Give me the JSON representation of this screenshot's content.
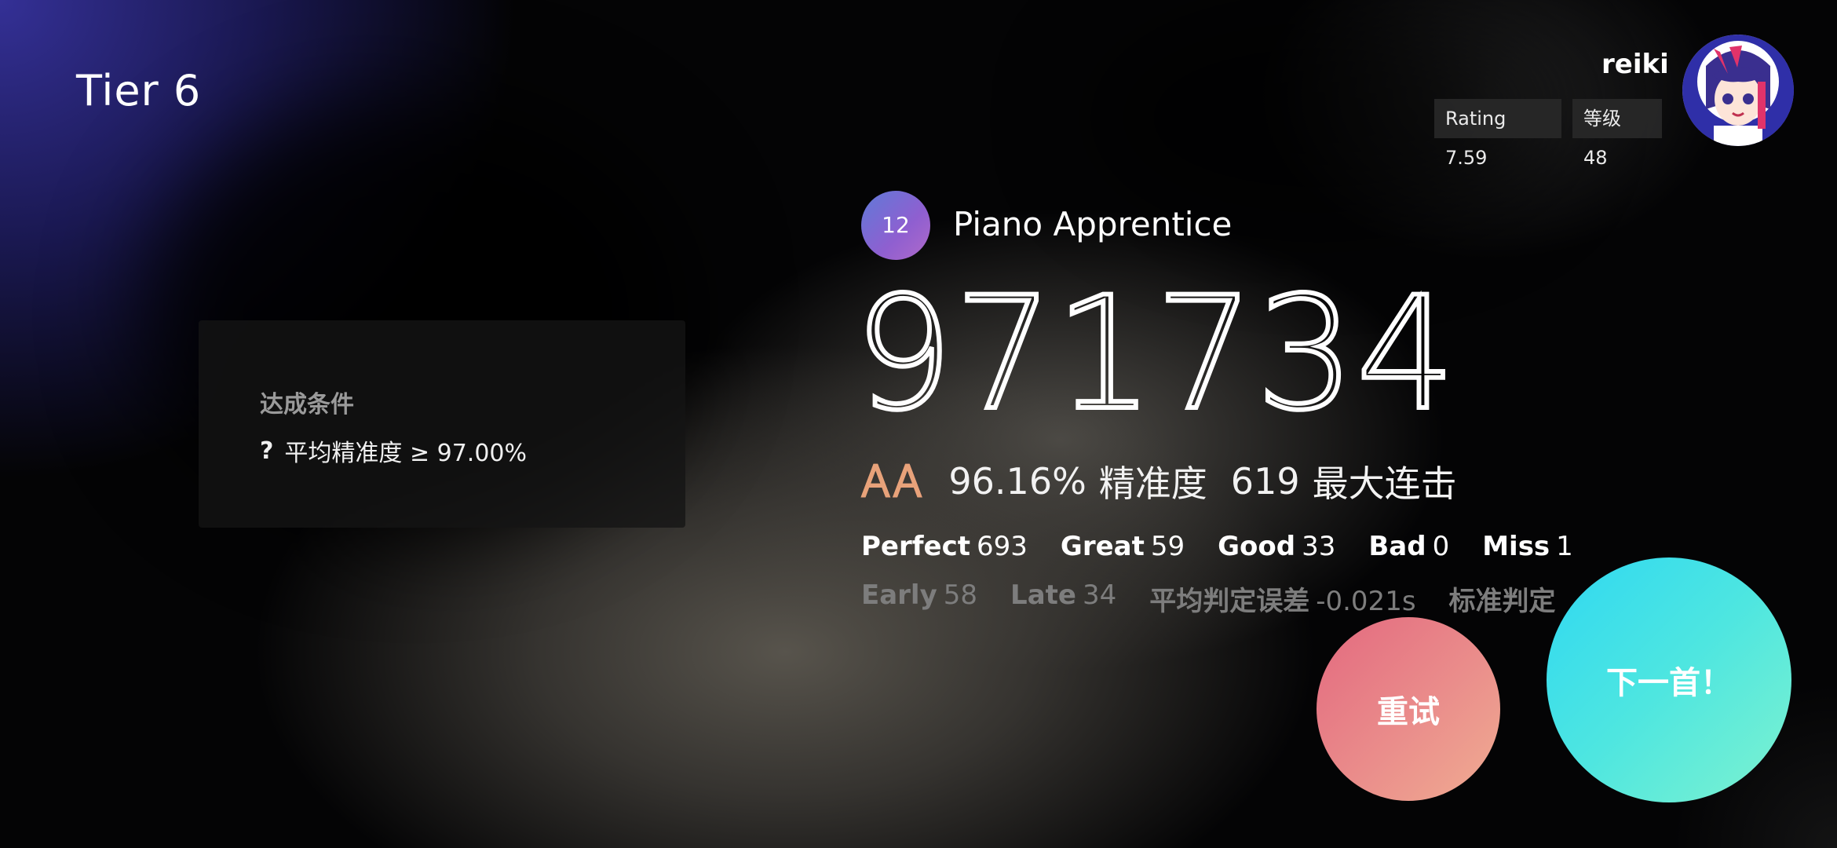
{
  "tier": {
    "title": "Tier 6"
  },
  "player": {
    "name": "reiki",
    "rating_label": "Rating 7.59",
    "level_label": "等级 48",
    "avatar_icon": "anime-avatar"
  },
  "conditions": {
    "title": "达成条件",
    "items": [
      {
        "icon": "?",
        "text": "平均精准度 ≥ 97.00%"
      }
    ]
  },
  "song": {
    "level": "12",
    "title": "Piano Apprentice"
  },
  "result": {
    "score": "971734",
    "grade": "AA",
    "accuracy": "96.16%",
    "accuracy_label": "精准度",
    "max_combo": "619",
    "max_combo_label": "最大连击"
  },
  "judgements": [
    {
      "label": "Perfect",
      "value": "693"
    },
    {
      "label": "Great",
      "value": "59"
    },
    {
      "label": "Good",
      "value": "33"
    },
    {
      "label": "Bad",
      "value": "0"
    },
    {
      "label": "Miss",
      "value": "1"
    }
  ],
  "timing": {
    "early_label": "Early",
    "early_value": "58",
    "late_label": "Late",
    "late_value": "34",
    "avg_offset_label": "平均判定误差",
    "avg_offset_value": "-0.021s",
    "std_offset_label": "标准判定"
  },
  "buttons": {
    "retry": "重试",
    "next": "下一首！"
  },
  "colors": {
    "retry_gradient": [
      "#e3697f",
      "#f0ad92"
    ],
    "next_gradient": [
      "#2fd8f2",
      "#7ef2cf"
    ],
    "level_badge": "#7f6ad6",
    "grade_gradient": [
      "#f5c36b",
      "#e7788a"
    ]
  }
}
